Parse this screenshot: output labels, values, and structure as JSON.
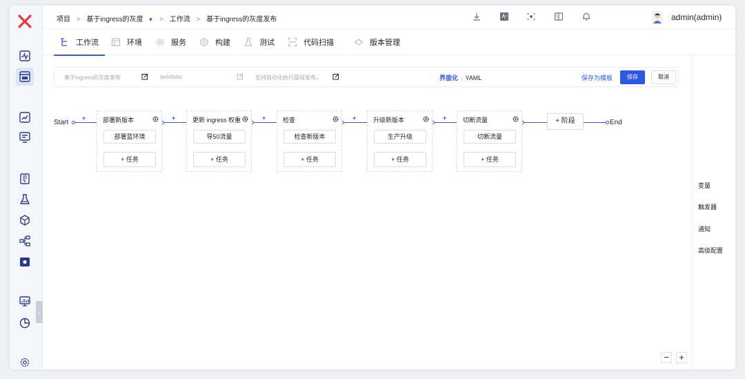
{
  "breadcrumb": {
    "project": "项目",
    "sep": ">",
    "project_name": "基于ingress的灰度",
    "caret": "▼",
    "workflow": "工作流",
    "workflow_name": "基于ingress的灰度发布"
  },
  "user": {
    "name": "admin(admin)"
  },
  "more_icon": "⋮",
  "tabs": [
    {
      "label": "工作流"
    },
    {
      "label": "环境"
    },
    {
      "label": "服务"
    },
    {
      "label": "构建"
    },
    {
      "label": "测试"
    },
    {
      "label": "代码扫描"
    },
    {
      "label": "版本管理"
    }
  ],
  "config": {
    "workflow_name_placeholder": "基于ingress的灰度发布",
    "workflow_key": "lanlvfabu",
    "description": "支持自动化执行蓝绿发布。",
    "mode_ui": "界面化",
    "mode_sep": "|",
    "mode_yaml": "YAML",
    "save_template": "保存为模板",
    "save": "保存",
    "cancel": "取消"
  },
  "flow": {
    "start": "Start",
    "end": "End",
    "plus": "+",
    "add_stage": "+ 阶段",
    "add_task": "+ 任务",
    "stages": [
      {
        "title": "部署新版本",
        "job": "部署蓝环境"
      },
      {
        "title": "更新 ingress 权重",
        "job": "导50流量"
      },
      {
        "title": "检查",
        "job": "检查新版本"
      },
      {
        "title": "升级新版本",
        "job": "生产升级"
      },
      {
        "title": "切断流量",
        "job": "切断流量"
      }
    ]
  },
  "right_panel": {
    "variables": "变量",
    "triggers": "触发器",
    "notifications": "通知",
    "advanced": "高级配置"
  },
  "zoom": {
    "out": "−",
    "in": "+"
  },
  "collapse_handle": "›",
  "colors": {
    "accent": "#2f57e6",
    "logo": "#e53935",
    "sidebar_icon": "#2a3a8a"
  }
}
